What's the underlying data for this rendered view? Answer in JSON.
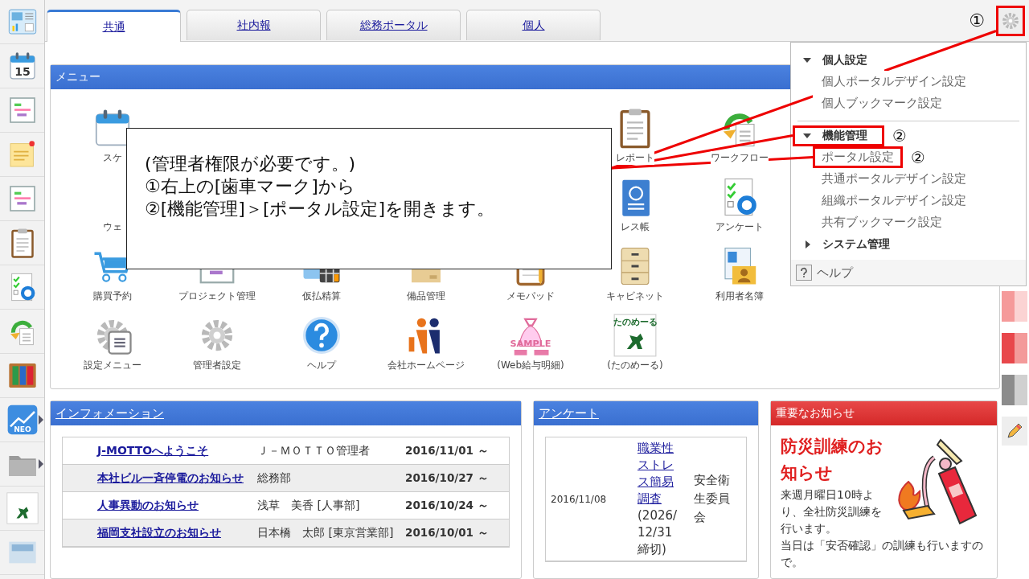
{
  "sidebar": {
    "items": [
      {
        "has_submenu": false
      },
      {
        "has_submenu": false,
        "text": "15"
      },
      {
        "has_submenu": false
      },
      {
        "has_submenu": false
      },
      {
        "has_submenu": false
      },
      {
        "has_submenu": false
      },
      {
        "has_submenu": false
      },
      {
        "has_submenu": false
      },
      {
        "has_submenu": false
      },
      {
        "has_submenu": true,
        "text": "NEO"
      },
      {
        "has_submenu": true
      },
      {
        "has_submenu": false
      },
      {
        "has_submenu": false
      }
    ]
  },
  "tabs": [
    {
      "label": "共通",
      "selected": true
    },
    {
      "label": "社内報",
      "selected": false
    },
    {
      "label": "総務ポータル",
      "selected": false
    },
    {
      "label": "個人",
      "selected": false
    }
  ],
  "settings_button": {
    "highlighted": true,
    "marker": "①"
  },
  "menu": {
    "title": "メニュー",
    "rows": [
      [
        {
          "label": "スケ"
        },
        {
          "label": "レポート"
        },
        {
          "label": "ワークフロー"
        }
      ],
      [
        {
          "label": "ウェ"
        },
        {
          "label": "レス帳"
        },
        {
          "label": "アンケート"
        }
      ],
      [
        {
          "label": "購買予約"
        },
        {
          "label": "プロジェクト管理"
        },
        {
          "label": "仮払精算"
        },
        {
          "label": "備品管理"
        },
        {
          "label": "メモパッド"
        },
        {
          "label": "キャビネット"
        },
        {
          "label": "利用者名簿"
        }
      ],
      [
        {
          "label": "設定メニュー"
        },
        {
          "label": "管理者設定"
        },
        {
          "label": "ヘルプ"
        },
        {
          "label": "会社ホームページ"
        },
        {
          "label": "(Web給与明細)",
          "icon_text": "SAMPLE"
        },
        {
          "label": "(たのめーる)",
          "icon_text": "たのめーる"
        }
      ]
    ]
  },
  "callout": {
    "lines": [
      "(管理者権限が必要です。)",
      "①右上の[歯車マーク]から",
      "②[機能管理]＞[ポータル設定]を開きます。"
    ]
  },
  "settings_menu": {
    "sections": [
      {
        "label": "個人設定",
        "expanded": true,
        "highlighted": false,
        "items": [
          {
            "label": "個人ポータルデザイン設定",
            "highlighted": false
          },
          {
            "label": "個人ブックマーク設定",
            "highlighted": false
          }
        ]
      },
      {
        "label": "機能管理",
        "expanded": true,
        "highlighted": true,
        "marker": "②",
        "items": [
          {
            "label": "ポータル設定",
            "highlighted": true,
            "marker": "②"
          },
          {
            "label": "共通ポータルデザイン設定",
            "highlighted": false
          },
          {
            "label": "組織ポータルデザイン設定",
            "highlighted": false
          },
          {
            "label": "共有ブックマーク設定",
            "highlighted": false
          }
        ]
      },
      {
        "label": "システム管理",
        "expanded": false,
        "highlighted": false
      }
    ],
    "help": "ヘルプ"
  },
  "information": {
    "title": "インフォメーション",
    "rows": [
      {
        "title": "J-MOTTOへようこそ",
        "author": "Ｊ－ＭＯＴＴＯ管理者",
        "date": "2016/11/01 ～"
      },
      {
        "title": "本社ビル一斉停電のお知らせ",
        "author": "総務部",
        "date": "2016/10/27 ～"
      },
      {
        "title": "人事異動のお知らせ",
        "author": "浅草　美香 [人事部]",
        "date": "2016/10/24 ～"
      },
      {
        "title": "福岡支社設立のお知らせ",
        "author": "日本橋　太郎 [東京営業部]",
        "date": "2016/10/01 ～"
      }
    ]
  },
  "survey": {
    "title": "アンケート",
    "rows": [
      {
        "date": "2016/11/08",
        "title": "職業性ストレス簡易調査",
        "deadline": "(2026/12/31締切)",
        "author": "安全衛生委員会"
      }
    ]
  },
  "notice": {
    "title": "重要なお知らせ",
    "headline": "防災訓練のお知らせ",
    "paragraphs": [
      "来週月曜日10時より、全社防災訓練を行います。",
      "当日は「安否確認」の訓練も行いますので。"
    ]
  }
}
